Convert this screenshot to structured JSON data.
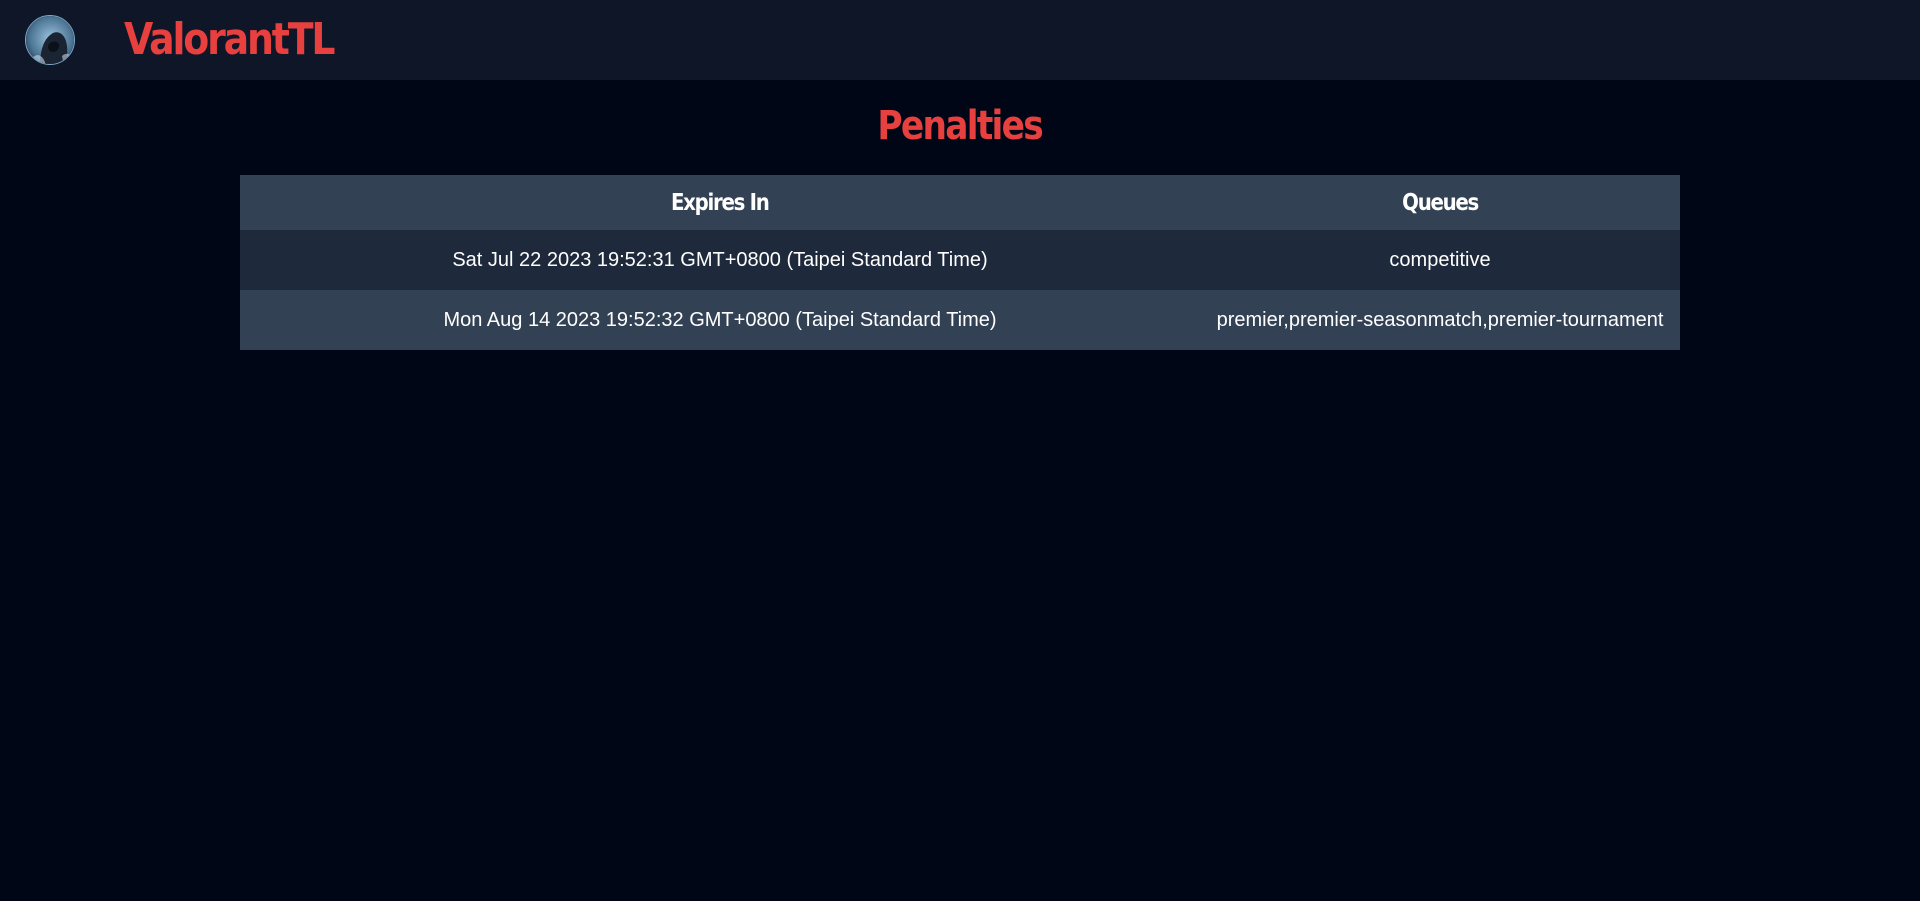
{
  "header": {
    "brand": "ValorantTL",
    "avatar_icon": "hooded-agent-avatar-icon"
  },
  "main": {
    "title": "Penalties",
    "table": {
      "columns": [
        "Expires In",
        "Queues"
      ],
      "rows": [
        {
          "expires_in": "Sat Jul 22 2023 19:52:31 GMT+0800 (Taipei Standard Time)",
          "queues": "competitive"
        },
        {
          "expires_in": "Mon Aug 14 2023 19:52:32 GMT+0800 (Taipei Standard Time)",
          "queues": "premier,premier-seasonmatch,premier-tournament"
        }
      ]
    }
  },
  "colors": {
    "background": "#010616",
    "topbar": "#0e1628",
    "accent": "#e8403f",
    "header_row": "#334155",
    "row_odd": "#1e293b",
    "row_even": "#334155"
  }
}
